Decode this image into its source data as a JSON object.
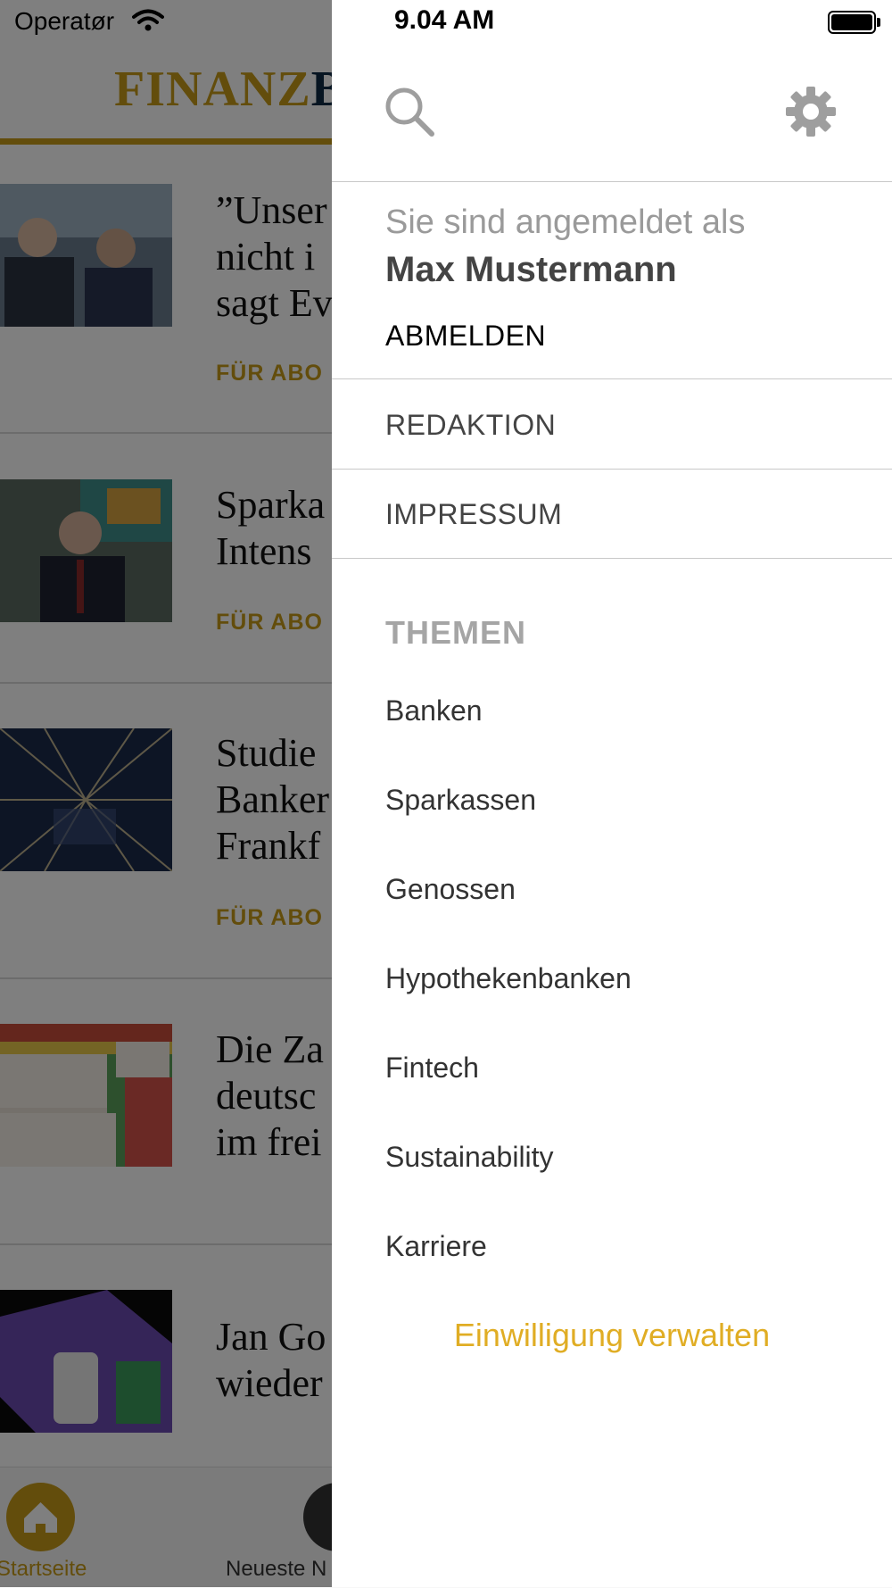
{
  "statusbar": {
    "carrier": "Operatør",
    "time": "9.04 AM"
  },
  "app": {
    "logo_highlight": "FINANZ",
    "logo_rest": "B",
    "articles": [
      {
        "title": "”Unser\nnicht i\nsagt Ev",
        "tag": "FÜR ABO"
      },
      {
        "title": "Sparka\nIntens",
        "tag": "FÜR ABO"
      },
      {
        "title": "Studie\nBanker\nFrankf",
        "tag": "FÜR ABO"
      },
      {
        "title": "Die Za\ndeutsc\nim frei",
        "tag": ""
      },
      {
        "title": "Jan Go\nwieder",
        "tag": ""
      }
    ],
    "tabs": {
      "home_label": "Startseite",
      "news_label": "Neueste N"
    }
  },
  "drawer": {
    "logged_in_as": "Sie sind angemeldet als",
    "user_name": "Max Mustermann",
    "logout_label": "ABMELDEN",
    "menu": [
      "REDAKTION",
      "IMPRESSUM"
    ],
    "themes_heading": "THEMEN",
    "topics": [
      "Banken",
      "Sparkassen",
      "Genossen",
      "Hypothekenbanken",
      "Fintech",
      "Sustainability",
      "Karriere"
    ],
    "consent_label": "Einwilligung verwalten"
  },
  "colors": {
    "accent": "#c69b19",
    "link": "#e0ad24",
    "logo_dark": "#0f2a44"
  }
}
